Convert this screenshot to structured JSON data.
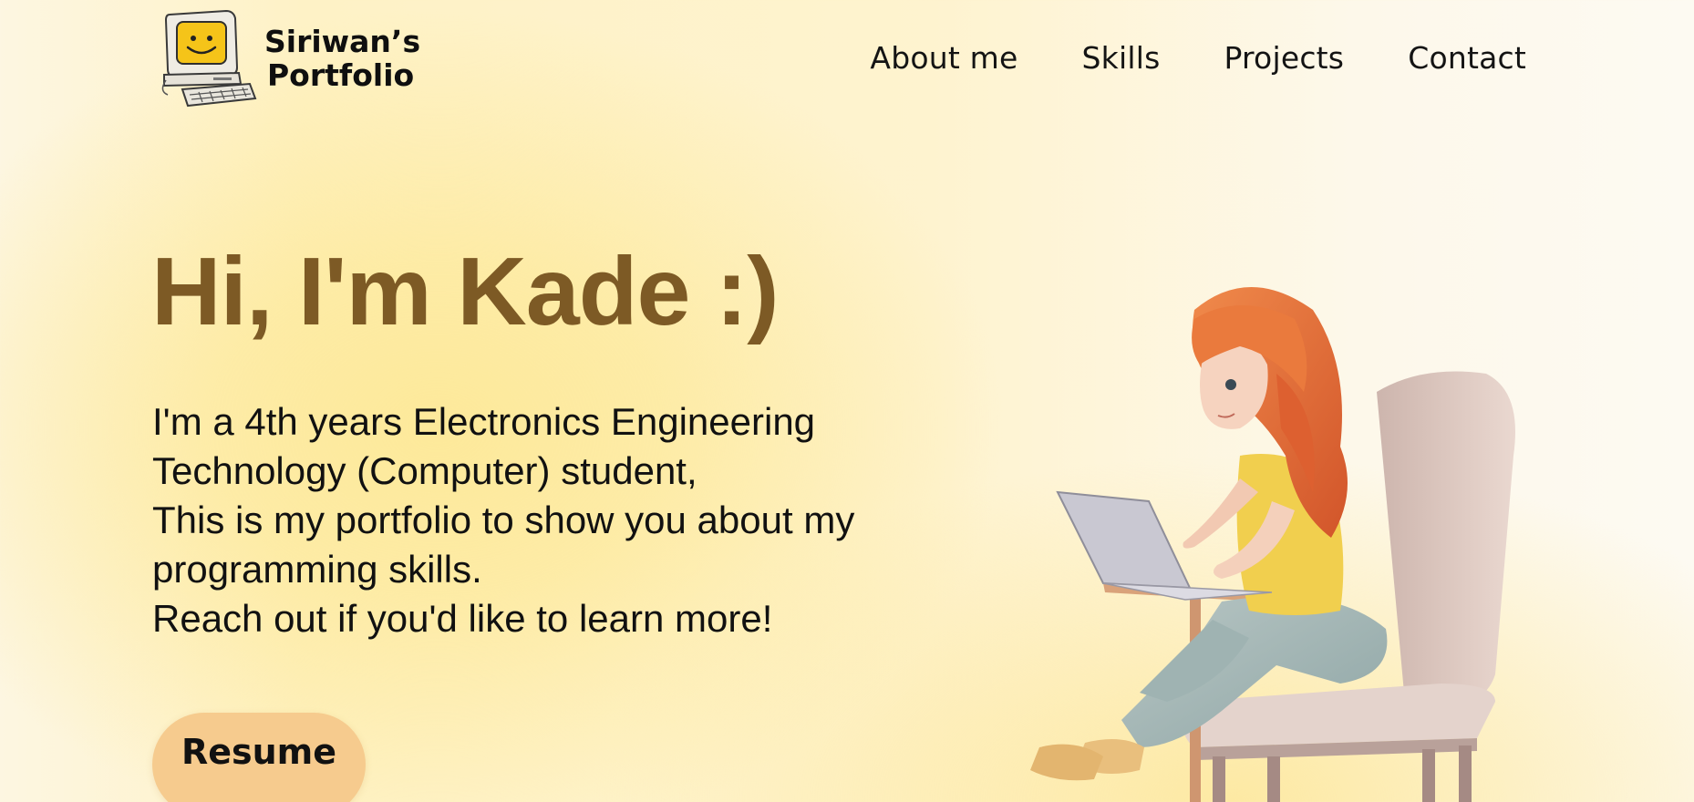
{
  "header": {
    "logo_line1": "Siriwan’s",
    "logo_line2": "Portfolio",
    "nav": [
      {
        "label": "About me"
      },
      {
        "label": "Skills"
      },
      {
        "label": "Projects"
      },
      {
        "label": "Contact"
      }
    ]
  },
  "hero": {
    "title": "Hi, I'm Kade :)",
    "lines": [
      "I'm a 4th years Electronics Engineering",
      "Technology (Computer) student,",
      "This is my portfolio to show you about my",
      "programming skills.",
      "Reach out if you'd like to learn more!"
    ],
    "resume_label": "Resume"
  },
  "icons": {
    "logo": "retro-computer-smiley-icon",
    "illustration": "girl-with-laptop-on-chair"
  },
  "colors": {
    "title": "#7d5a25",
    "button": "#f6cb8e",
    "background": "#fef3cf"
  }
}
